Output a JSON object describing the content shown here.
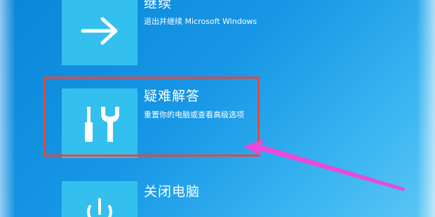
{
  "options": [
    {
      "title": "继续",
      "description": "退出并继续 Microsoft Windows",
      "icon": "arrow-right-icon"
    },
    {
      "title": "疑难解答",
      "description": "重置你的电脑或查看高级选项",
      "icon": "tools-icon"
    },
    {
      "title": "关闭电脑",
      "description": "",
      "icon": "power-icon"
    }
  ],
  "annotation": {
    "highlight_color": "#e8473a",
    "arrow_color": "#e94ad6"
  },
  "colors": {
    "background": "#1797e6",
    "tile": "#33c0ee",
    "text": "#ffffff"
  }
}
